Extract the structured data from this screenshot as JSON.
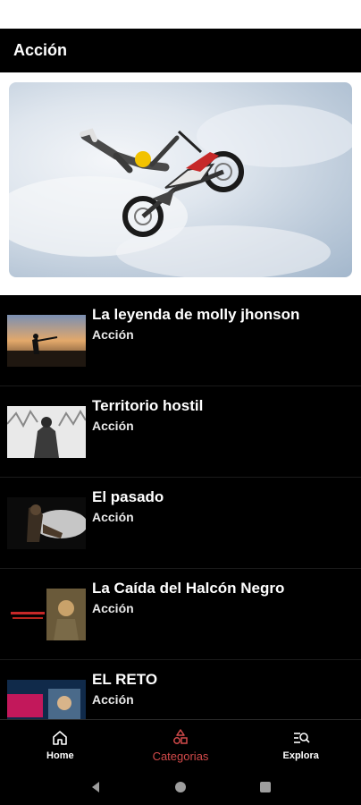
{
  "app_bar": {
    "title": "Acción"
  },
  "banner": {
    "image": "motocross-jump-photo"
  },
  "movies": [
    {
      "title": "La leyenda de molly jhonson",
      "genre": "Acción",
      "thumb": "sunset-hunter-thumb"
    },
    {
      "title": "Territorio hostil",
      "genre": "Acción",
      "thumb": "winter-soldier-thumb"
    },
    {
      "title": "El pasado",
      "genre": "Acción",
      "thumb": "dark-rider-thumb"
    },
    {
      "title": "La Caída del Halcón Negro",
      "genre": "Acción",
      "thumb": "halcon-negro-thumb"
    },
    {
      "title": "EL RETO",
      "genre": "Acción",
      "thumb": "el-reto-thumb"
    }
  ],
  "bottom_nav": {
    "items": [
      {
        "label": "Home",
        "icon": "home-icon",
        "active": false
      },
      {
        "label": "Categorias",
        "icon": "shapes-icon",
        "active": true
      },
      {
        "label": "Explora",
        "icon": "search-list-icon",
        "active": false
      }
    ]
  },
  "colors": {
    "accent": "#d24a4a",
    "background": "#000000"
  }
}
